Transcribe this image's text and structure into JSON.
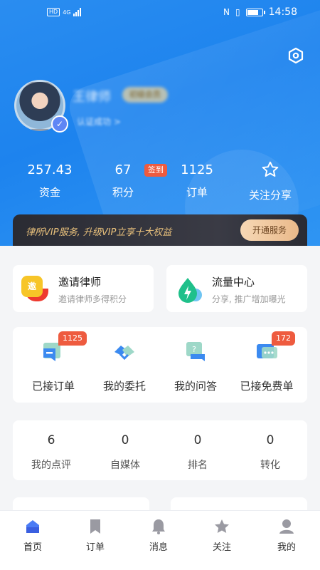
{
  "status_bar": {
    "hd_label": "HD",
    "network_label": "4G",
    "time": "14:58"
  },
  "header": {
    "settings_icon": "settings-hex-icon",
    "name": "王律师",
    "level": "初级会员",
    "verify_text": "认证成功 >"
  },
  "stats": [
    {
      "value": "257.43",
      "label": "资金"
    },
    {
      "value": "67",
      "label": "积分"
    },
    {
      "value": "1125",
      "label": "订单"
    },
    {
      "label": "关注分享",
      "icon": "star-outline-icon"
    }
  ],
  "sign_badge": "签到",
  "vip": {
    "text": "律所VIP服务, 升级VIP立享十大权益",
    "button": "开通服务",
    "accent": "#e9c17c"
  },
  "promos": [
    {
      "title": "邀请律师",
      "subtitle": "邀请律师多得积分",
      "icon_text": "邀"
    },
    {
      "title": "流量中心",
      "subtitle": "分享, 推广增加曝光"
    }
  ],
  "quick": [
    {
      "label": "已接订单",
      "badge": "1125"
    },
    {
      "label": "我的委托"
    },
    {
      "label": "我的问答"
    },
    {
      "label": "已接免费单",
      "badge": "172"
    }
  ],
  "metrics": [
    {
      "value": "6",
      "label": "我的点评"
    },
    {
      "value": "0",
      "label": "自媒体"
    },
    {
      "value": "0",
      "label": "排名"
    },
    {
      "value": "0",
      "label": "转化"
    }
  ],
  "tabs": [
    {
      "label": "首页",
      "active": true
    },
    {
      "label": "订单"
    },
    {
      "label": "消息"
    },
    {
      "label": "关注"
    },
    {
      "label": "我的"
    }
  ],
  "colors": {
    "primary": "#1d83ee",
    "badge": "#ee5b3f",
    "vip_dark": "#2a2b33"
  }
}
